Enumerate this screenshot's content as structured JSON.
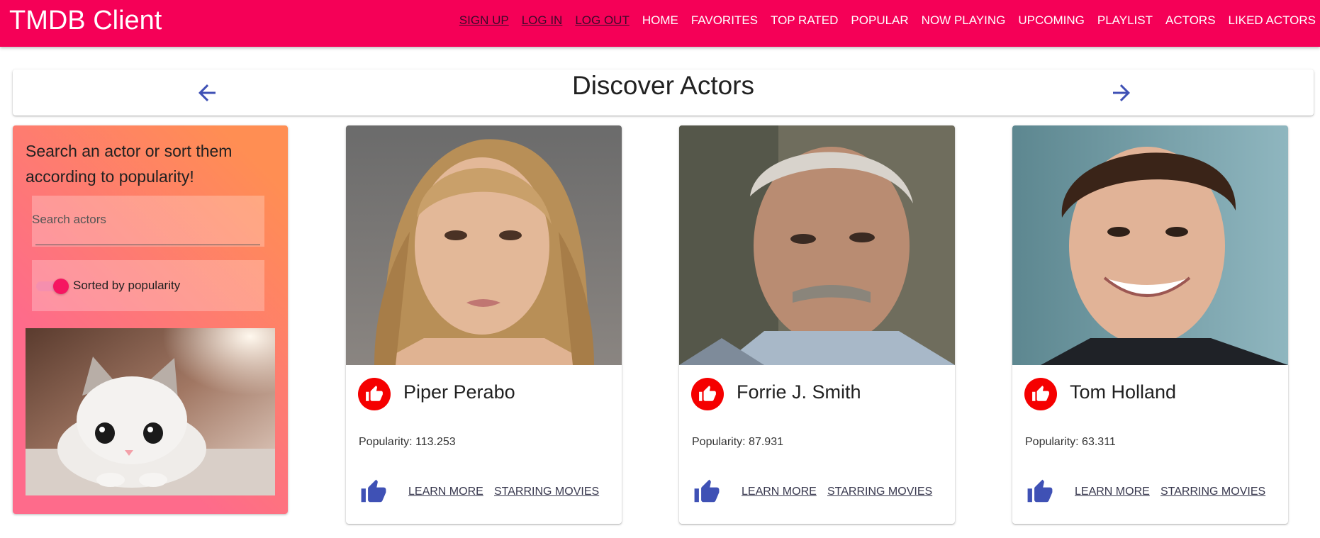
{
  "app": {
    "title": "TMDB Client"
  },
  "nav": {
    "items": [
      {
        "label": "SIGN UP"
      },
      {
        "label": "LOG IN"
      },
      {
        "label": "LOG OUT"
      },
      {
        "label": "HOME"
      },
      {
        "label": "FAVORITES"
      },
      {
        "label": "TOP RATED"
      },
      {
        "label": "POPULAR"
      },
      {
        "label": "NOW PLAYING"
      },
      {
        "label": "UPCOMING"
      },
      {
        "label": "PLAYLIST"
      },
      {
        "label": "ACTORS"
      },
      {
        "label": "LIKED ACTORS"
      }
    ]
  },
  "header": {
    "title": "Discover Actors"
  },
  "filter": {
    "description": "Search an actor or sort them according to popularity!",
    "search_placeholder": "Search actors",
    "search_value": "",
    "sort_label": "Sorted by popularity",
    "sort_enabled": true
  },
  "actors": [
    {
      "name": "Piper Perabo",
      "popularity_label": "Popularity:",
      "popularity": "113.253",
      "learn_more": "LEARN MORE",
      "starring": "STARRING MOVIES"
    },
    {
      "name": "Forrie J. Smith",
      "popularity_label": "Popularity:",
      "popularity": "87.931",
      "learn_more": "LEARN MORE",
      "starring": "STARRING MOVIES"
    },
    {
      "name": "Tom Holland",
      "popularity_label": "Popularity:",
      "popularity": "63.311",
      "learn_more": "LEARN MORE",
      "starring": "STARRING MOVIES"
    }
  ],
  "colors": {
    "appbar": "#f50057",
    "accent_blue": "#3f51b5",
    "avatar_red": "#f50000",
    "gradient_start": "#fe6b8b",
    "gradient_end": "#ff8e53"
  },
  "icons": {
    "prev": "arrow-back-icon",
    "next": "arrow-forward-icon",
    "avatar": "thumb-up-icon",
    "like": "thumb-up-icon"
  }
}
